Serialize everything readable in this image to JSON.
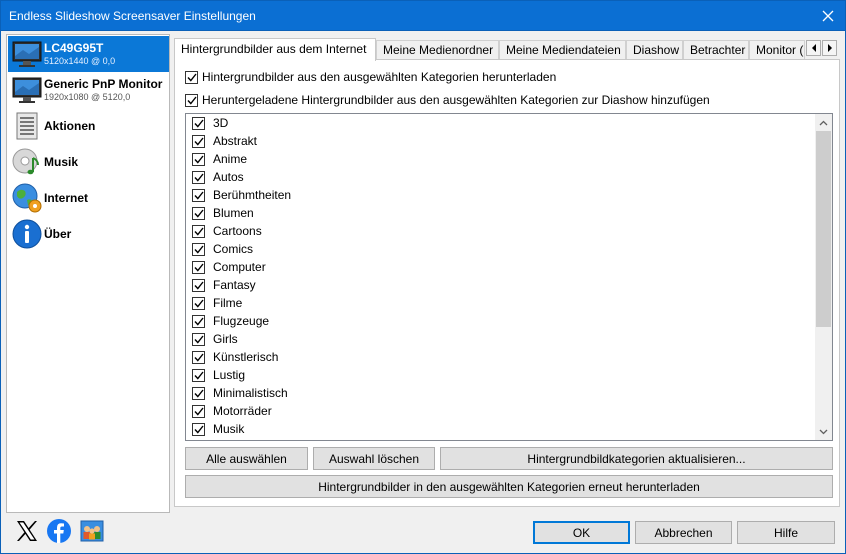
{
  "window": {
    "title": "Endless Slideshow Screensaver Einstellungen"
  },
  "sidebar": {
    "items": [
      {
        "label": "LC49G95T",
        "sub": "5120x1440 @ 0,0",
        "icon": "monitor-icon"
      },
      {
        "label": "Generic PnP Monitor",
        "sub": "1920x1080 @ 5120,0",
        "icon": "monitor-icon"
      },
      {
        "label": "Aktionen",
        "icon": "actions-list-icon"
      },
      {
        "label": "Musik",
        "icon": "music-cd-icon"
      },
      {
        "label": "Internet",
        "icon": "globe-gear-icon"
      },
      {
        "label": "Über",
        "icon": "info-icon"
      }
    ]
  },
  "tabs": [
    {
      "label": "Hintergrundbilder aus dem Internet"
    },
    {
      "label": "Meine Medienordner"
    },
    {
      "label": "Meine Mediendateien"
    },
    {
      "label": "Diashow"
    },
    {
      "label": "Betrachter"
    },
    {
      "label": "Monitor ("
    }
  ],
  "options": {
    "download_label": "Hintergrundbilder aus den ausgewählten Kategorien herunterladen",
    "add_label": "Heruntergeladene Hintergrundbilder aus den ausgewählten Kategorien zur Diashow hinzufügen"
  },
  "categories": [
    "3D",
    "Abstrakt",
    "Anime",
    "Autos",
    "Berühmtheiten",
    "Blumen",
    "Cartoons",
    "Comics",
    "Computer",
    "Fantasy",
    "Filme",
    "Flugzeuge",
    "Girls",
    "Künstlerisch",
    "Lustig",
    "Minimalistisch",
    "Motorräder",
    "Musik"
  ],
  "buttons": {
    "select_all": "Alle auswählen",
    "clear_selection": "Auswahl löschen",
    "refresh_categories": "Hintergrundbildkategorien aktualisieren...",
    "redownload": "Hintergrundbilder in den ausgewählten Kategorien erneut herunterladen",
    "ok": "OK",
    "cancel": "Abbrechen",
    "help": "Hilfe"
  },
  "colors": {
    "titlebar": "#0b6fd3",
    "selection": "#0b78d7",
    "default_button_border": "#0078d7"
  }
}
